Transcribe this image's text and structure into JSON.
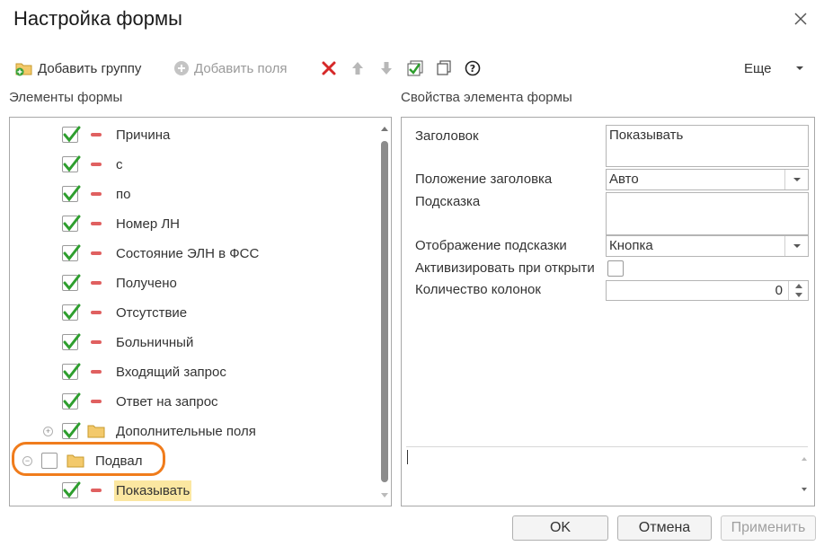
{
  "window": {
    "title": "Настройка формы"
  },
  "toolbar": {
    "add_group": "Добавить группу",
    "add_field": "Добавить поля",
    "more": "Еще"
  },
  "left": {
    "header": "Элементы формы"
  },
  "right": {
    "header": "Свойства элемента формы"
  },
  "tree": {
    "items": [
      {
        "label": "Причина",
        "checked": true,
        "kind": "field"
      },
      {
        "label": "с",
        "checked": true,
        "kind": "field"
      },
      {
        "label": "по",
        "checked": true,
        "kind": "field"
      },
      {
        "label": "Номер ЛН",
        "checked": true,
        "kind": "field"
      },
      {
        "label": "Состояние ЭЛН в ФСС",
        "checked": true,
        "kind": "field"
      },
      {
        "label": "Получено",
        "checked": true,
        "kind": "field"
      },
      {
        "label": "Отсутствие",
        "checked": true,
        "kind": "field"
      },
      {
        "label": "Больничный",
        "checked": true,
        "kind": "field"
      },
      {
        "label": "Входящий запрос",
        "checked": true,
        "kind": "field"
      },
      {
        "label": "Ответ на запрос",
        "checked": true,
        "kind": "field"
      },
      {
        "label": "Дополнительные поля",
        "checked": true,
        "kind": "group",
        "expander": "+"
      },
      {
        "label": "Подвал",
        "checked": false,
        "kind": "group",
        "expander": "−"
      },
      {
        "label": "Показывать",
        "checked": true,
        "kind": "field",
        "selected": true
      }
    ]
  },
  "properties": {
    "caption_label": "Заголовок",
    "caption_value": "Показывать",
    "caption_position_label": "Положение заголовка",
    "caption_position_value": "Авто",
    "tooltip_label": "Подсказка",
    "tooltip_value": "",
    "tooltip_display_label": "Отображение подсказки",
    "tooltip_display_value": "Кнопка",
    "activate_label": "Активизировать при открыти",
    "activate_checked": false,
    "columns_label": "Количество колонок",
    "columns_value": "0"
  },
  "buttons": {
    "ok": "OK",
    "cancel": "Отмена",
    "apply": "Применить"
  },
  "colors": {
    "check_green": "#2e9e2e",
    "delete_red": "#d62828",
    "minus_red": "#e06060",
    "folder_yellow": "#f3c96b",
    "highlight": "#fbe7a1",
    "callout_orange": "#f07c1c"
  }
}
